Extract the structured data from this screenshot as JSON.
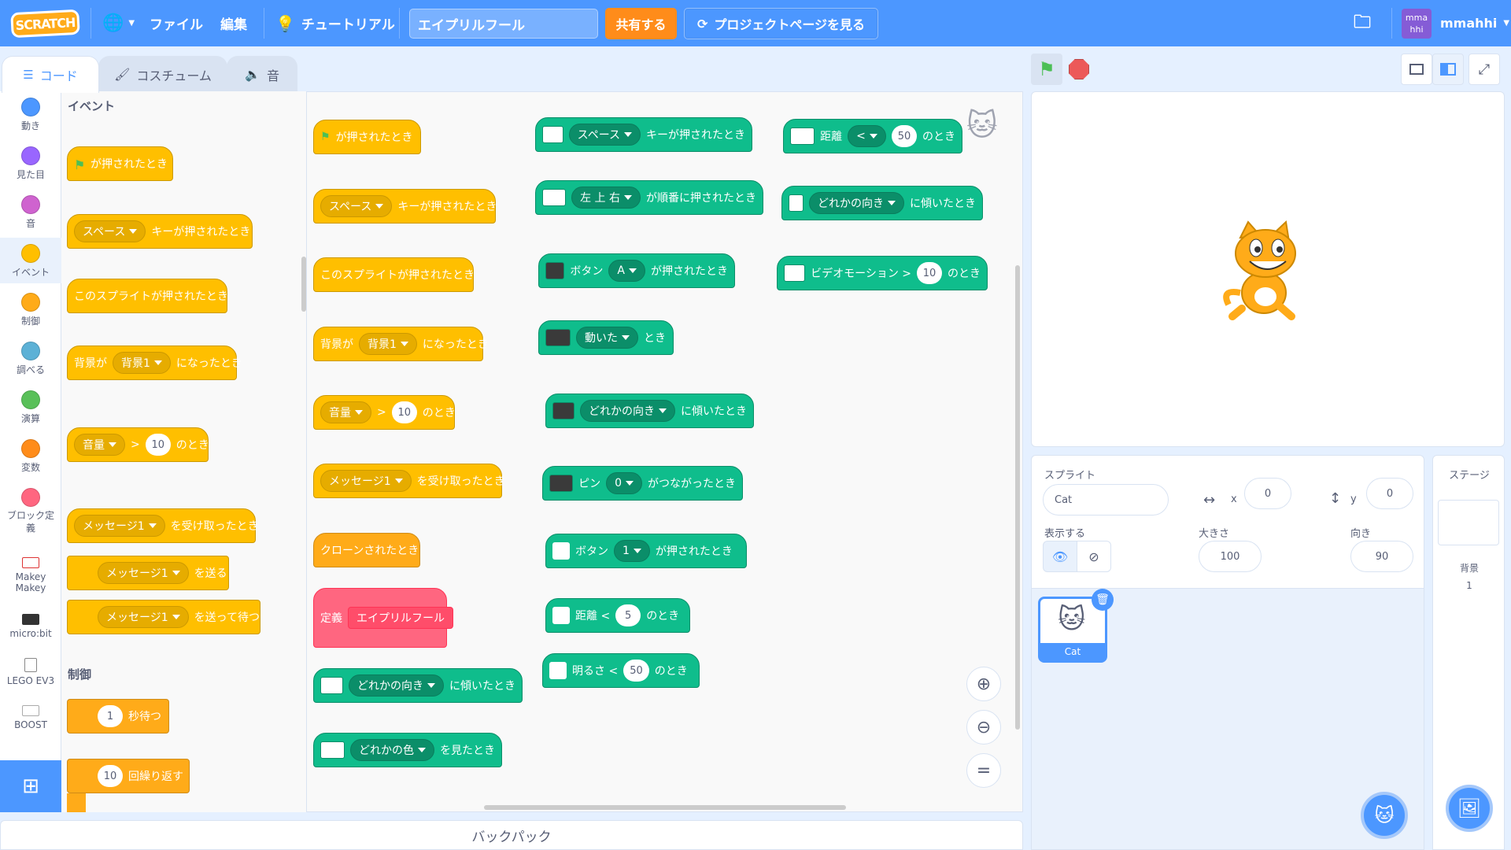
{
  "menubar": {
    "logo": "SCRATCH",
    "file": "ファイル",
    "edit": "編集",
    "tutorials": "チュートリアル",
    "project_title": "エイプリルフール",
    "share": "共有する",
    "see_project": "プロジェクトページを見る",
    "username": "mmahhi",
    "avatar_text": "mma hhi"
  },
  "tabs": {
    "code": "コード",
    "costumes": "コスチューム",
    "sounds": "音"
  },
  "categories": [
    {
      "label": "動き",
      "color": "#4c97ff"
    },
    {
      "label": "見た目",
      "color": "#9966ff"
    },
    {
      "label": "音",
      "color": "#cf63cf"
    },
    {
      "label": "イベント",
      "color": "#ffbf00"
    },
    {
      "label": "制御",
      "color": "#ffab19"
    },
    {
      "label": "調べる",
      "color": "#5cb1d6"
    },
    {
      "label": "演算",
      "color": "#59c059"
    },
    {
      "label": "変数",
      "color": "#ff8c1a"
    },
    {
      "label": "ブロック定義",
      "color": "#ff6680"
    }
  ],
  "extensions": [
    {
      "label": "Makey Makey"
    },
    {
      "label": "micro:bit"
    },
    {
      "label": "LEGO EV3"
    },
    {
      "label": "BOOST"
    }
  ],
  "palette": {
    "events_heading": "イベント",
    "control_heading": "制御",
    "flag_clicked": "が押されたとき",
    "key_space": "スペース",
    "key_pressed": "キーが押されたとき",
    "sprite_clicked": "このスプライトが押されたとき",
    "backdrop_prefix": "背景が",
    "backdrop_value": "背景1",
    "backdrop_suffix": "になったとき",
    "volume": "音量",
    "gt": ">",
    "ten": "10",
    "notoki": "のとき",
    "message1": "メッセージ1",
    "receive": "を受け取ったとき",
    "broadcast": "を送る",
    "broadcast_wait": "を送って待つ",
    "wait_num": "1",
    "wait_sec": "秒待つ",
    "repeat_num": "10",
    "repeat_label": "回繰り返す"
  },
  "workspace": {
    "clone_start": "クローンされたとき",
    "define": "定義",
    "define_name": "エイプリルフール",
    "any_direction": "どれかの向き",
    "tilted": "に傾いたとき",
    "any_color": "どれかの色",
    "seen_color": "を見たとき",
    "order_keys": "左 上 右",
    "pressed_in_order": "が順番に押されたとき",
    "button": "ボタン",
    "button_a": "A",
    "button_pressed": "が押されたとき",
    "moved": "動いた",
    "toki": "とき",
    "pin": "ピン",
    "pin_val": "0",
    "connected": "がつながったとき",
    "button_1": "1",
    "distance_lt": "距離 <",
    "dist_5": "5",
    "brightness_lt": "明るさ <",
    "val_50": "50",
    "distance": "距離",
    "lt": "<",
    "video_motion": "ビデオモーション >",
    "video_10": "10"
  },
  "sprite_info": {
    "sprite_label": "スプライト",
    "sprite_name": "Cat",
    "x_label": "x",
    "x_value": "0",
    "y_label": "y",
    "y_value": "0",
    "show_label": "表示する",
    "size_label": "大きさ",
    "size_value": "100",
    "direction_label": "向き",
    "direction_value": "90"
  },
  "sprite_list": [
    {
      "name": "Cat",
      "selected": true
    }
  ],
  "stage_panel": {
    "title": "ステージ",
    "backdrops_label": "背景",
    "backdrops_count": "1"
  },
  "backpack": "バックパック",
  "colors": {
    "accent": "#4c97ff",
    "events": "#ffbf00",
    "makey": "#0fbd8c",
    "define": "#ff6680",
    "share": "#ff8c1a"
  }
}
